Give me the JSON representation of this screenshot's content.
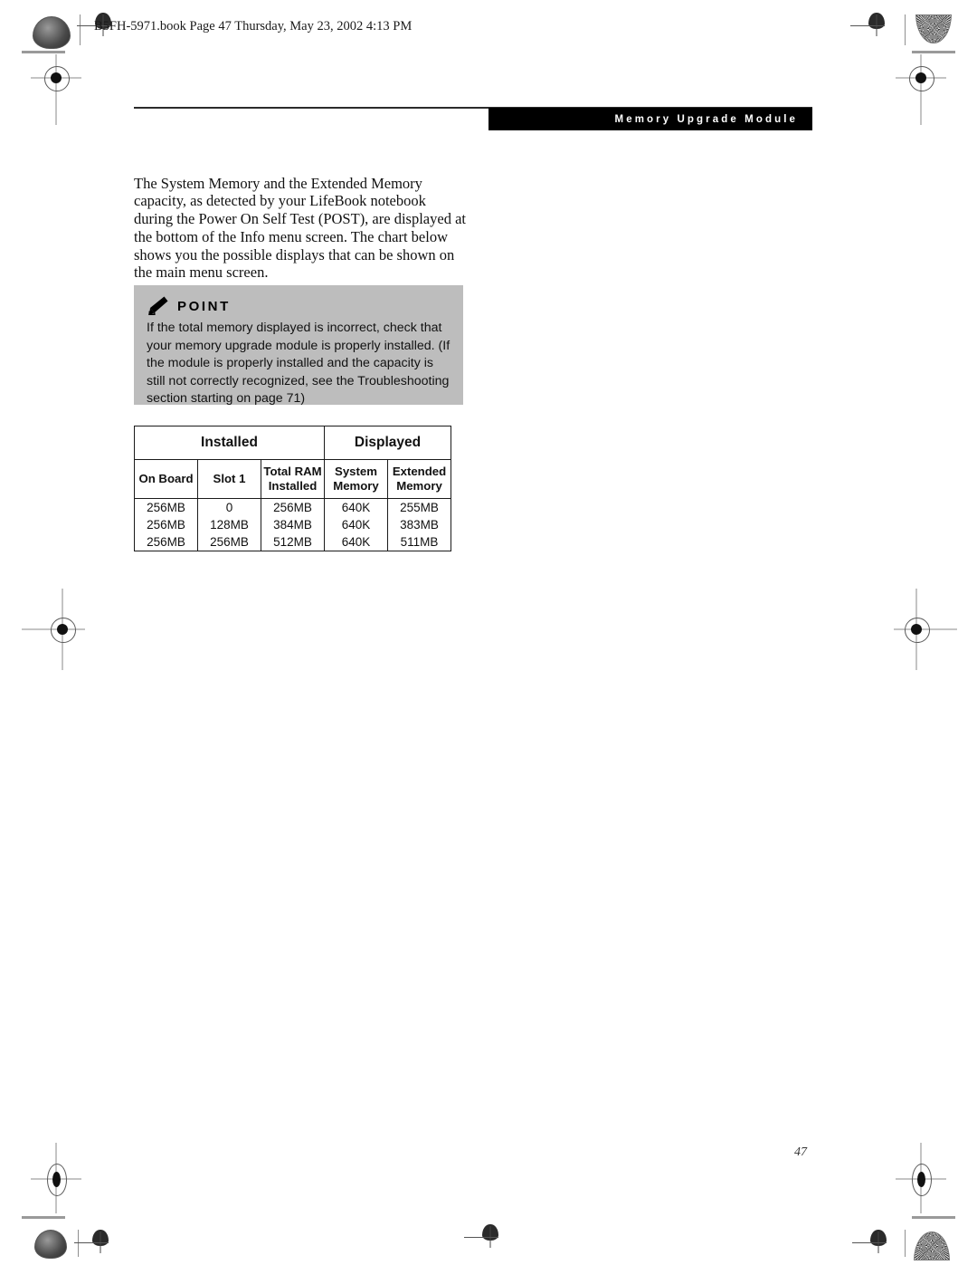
{
  "header": {
    "book_info": "B5FH-5971.book  Page 47  Thursday, May 23, 2002  4:13 PM"
  },
  "banner": {
    "title": "Memory Upgrade Module"
  },
  "body": {
    "paragraph": "The System Memory and the Extended Memory capacity, as detected by your LifeBook notebook during the Power On Self Test (POST), are displayed at the bottom of the Info menu screen. The chart below shows you the possible displays that can be shown on the main menu screen."
  },
  "point_box": {
    "title": "POINT",
    "icon": "pencil-icon",
    "background_color": "#bdbdbd",
    "text": "If the total memory displayed is incorrect, check that your memory upgrade module is properly installed. (If the module is properly installed and the capacity is still not correctly recognized, see the Troubleshooting section starting on page 71)"
  },
  "memory_table": {
    "group_headers": [
      "Installed",
      "Displayed"
    ],
    "column_headers": [
      "On Board",
      "Slot 1",
      "Total RAM Installed",
      "System Memory",
      "Extended Memory"
    ],
    "column_headers_lines": [
      [
        "On Board",
        ""
      ],
      [
        "Slot 1",
        ""
      ],
      [
        "Total RAM",
        "Installed"
      ],
      [
        "System",
        "Memory"
      ],
      [
        "Extended",
        "Memory"
      ]
    ],
    "rows": [
      [
        "256MB",
        "0",
        "256MB",
        "640K",
        "255MB"
      ],
      [
        "256MB",
        "128MB",
        "384MB",
        "640K",
        "383MB"
      ],
      [
        "256MB",
        "256MB",
        "512MB",
        "640K",
        "511MB"
      ]
    ]
  },
  "footer": {
    "page_number": "47"
  }
}
